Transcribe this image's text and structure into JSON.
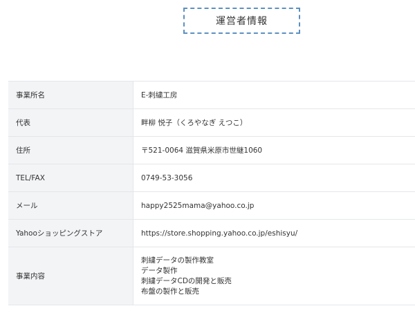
{
  "heading": {
    "title": "運営者情報"
  },
  "rows": [
    {
      "label": "事業所名",
      "value": "E-刺繍工房"
    },
    {
      "label": "代表",
      "value": "畔柳 悦子（くろやなぎ えつこ）"
    },
    {
      "label": "住所",
      "value": "〒521-0064 滋賀県米原市世継1060"
    },
    {
      "label": "TEL/FAX",
      "value": "0749-53-3056"
    },
    {
      "label": "メール",
      "value": "happy2525mama@yahoo.co.jp"
    },
    {
      "label": "Yahooショッピングストア",
      "value": "https://store.shopping.yahoo.co.jp/eshisyu/"
    },
    {
      "label": "事業内容",
      "lines": [
        "刺繍データの製作教室",
        "データ製作",
        "刺繍データCDの開発と販売",
        "布盤の製作と販売"
      ]
    }
  ]
}
